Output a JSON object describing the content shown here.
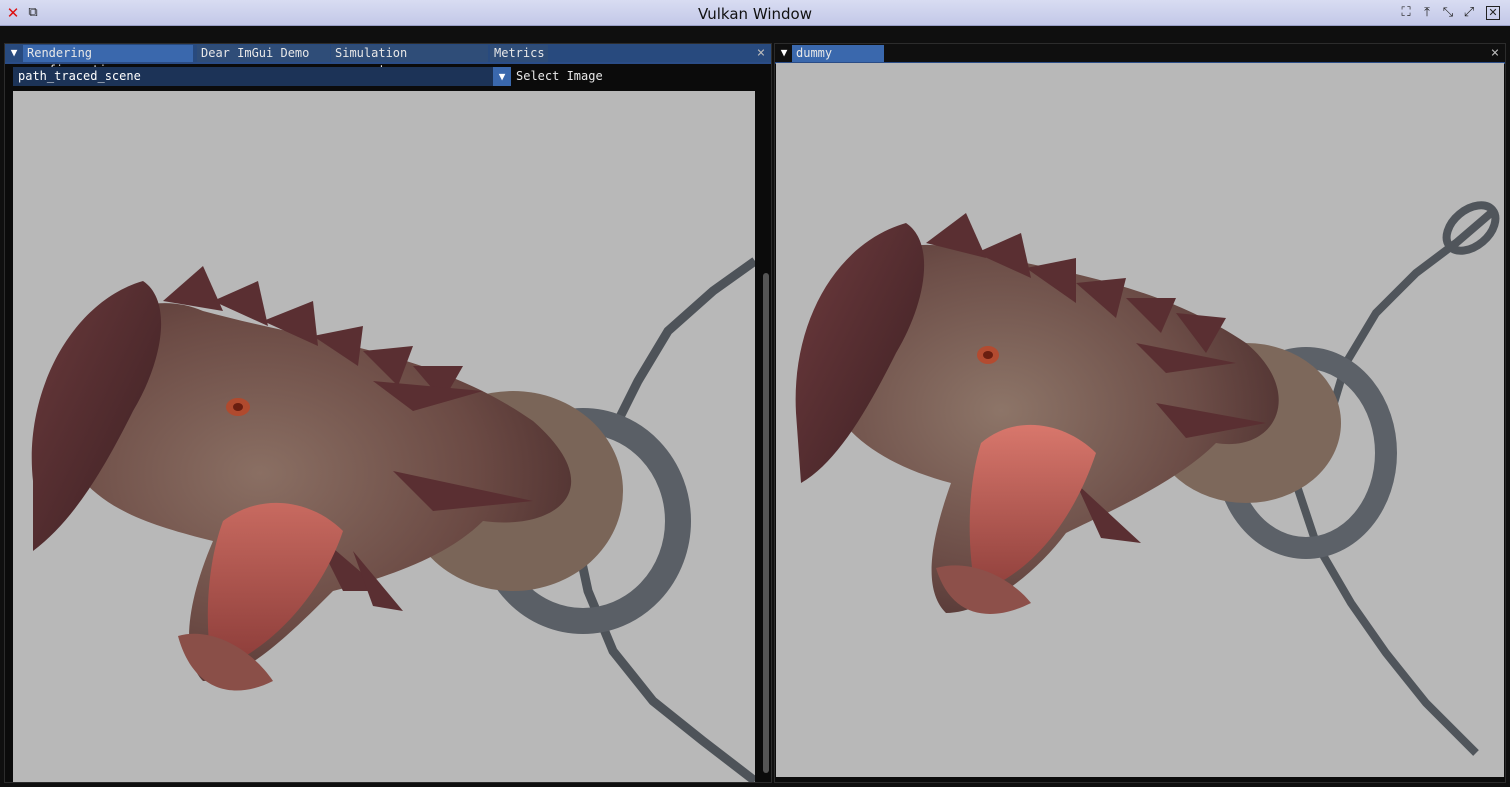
{
  "window": {
    "title": "Vulkan Window",
    "left_buttons": [
      "close-icon",
      "restore-icon"
    ],
    "right_buttons": [
      "fullscreen-icon",
      "keep-above-icon",
      "minimize-icon",
      "maximize-icon",
      "close-icon"
    ]
  },
  "left_panel": {
    "tabs": [
      {
        "label": "Rendering configuration",
        "active": true
      },
      {
        "label": "Dear ImGui Demo",
        "active": false
      },
      {
        "label": "Simulation parameters",
        "active": false
      },
      {
        "label": "Metrics",
        "active": false
      }
    ],
    "combo": {
      "value": "path_traced_scene",
      "label": "Select Image"
    },
    "viewport_image": "dragon-head-on-chain-render"
  },
  "right_panel": {
    "tabs": [
      {
        "label": "dummy window",
        "active": true
      }
    ],
    "viewport_image": "dragon-head-on-chain-render"
  },
  "colors": {
    "accent": "#3a68ad",
    "tab_bar": "#284a7e",
    "viewport_bg": "#b8b8b8"
  }
}
